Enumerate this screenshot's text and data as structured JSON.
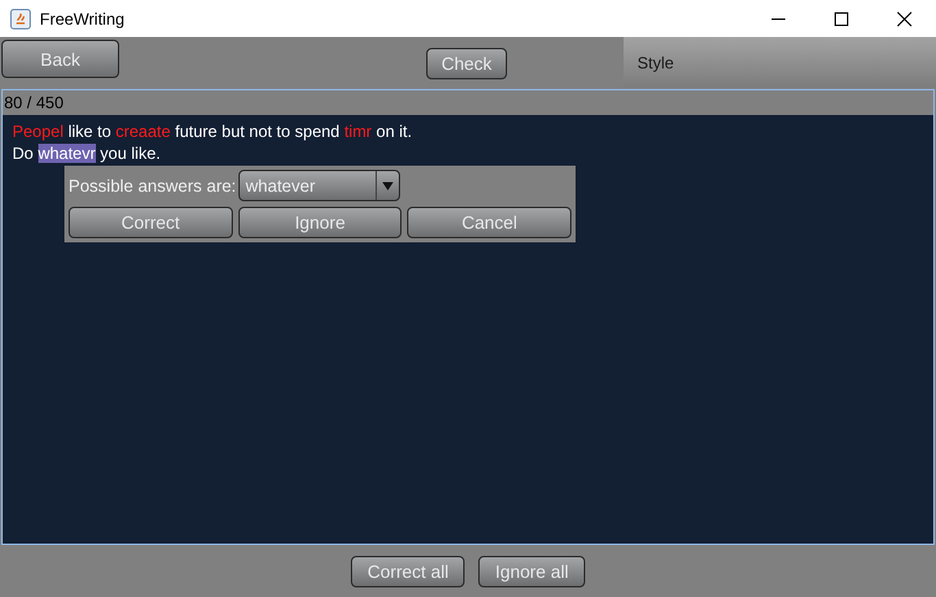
{
  "window": {
    "title": "FreeWriting"
  },
  "toolbar": {
    "back_button": "Back",
    "check_button": "Check",
    "style_label": "Style"
  },
  "editor": {
    "counter": "80 / 450",
    "lines": [
      [
        {
          "text": "Peopel",
          "kind": "error"
        },
        {
          "text": " like to ",
          "kind": "plain"
        },
        {
          "text": "creaate",
          "kind": "error"
        },
        {
          "text": " future but not to spend ",
          "kind": "plain"
        },
        {
          "text": "timr",
          "kind": "error"
        },
        {
          "text": " on it.",
          "kind": "plain"
        }
      ],
      [
        {
          "text": "Do ",
          "kind": "plain"
        },
        {
          "text": "whatevr",
          "kind": "selected"
        },
        {
          "text": " you like.",
          "kind": "plain"
        }
      ]
    ]
  },
  "suggestion_popup": {
    "label": "Possible answers are:",
    "answer": "whatever",
    "buttons": [
      "Correct",
      "Ignore",
      "Cancel"
    ]
  },
  "footer_buttons": [
    "Correct all",
    "Ignore all"
  ]
}
